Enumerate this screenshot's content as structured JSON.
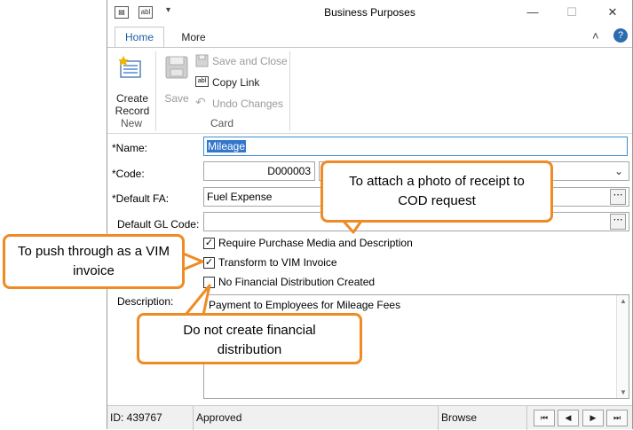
{
  "window": {
    "title": "Business Purposes",
    "minimize_glyph": "—",
    "restore_glyph": "☐",
    "close_glyph": "✕",
    "collapse_glyph": "˄",
    "help_glyph": "?"
  },
  "tabs": [
    {
      "label": "Home"
    },
    {
      "label": "More"
    }
  ],
  "ribbon": {
    "create_record": "Create Record",
    "save": "Save",
    "save_and_close": "Save and Close",
    "copy_link": "Copy Link",
    "undo_changes": "Undo Changes",
    "group_new": "New",
    "group_card": "Card"
  },
  "form": {
    "name_label": "*Name:",
    "name_value": "Mileage",
    "code_label": "*Code:",
    "code_value": "D000003",
    "default_fa_label": "*Default FA:",
    "default_fa_value": "Fuel Expense",
    "default_gl_label": "Default GL Code:",
    "default_gl_value": "",
    "chk_require_label": "Require Purchase Media and Description",
    "chk_transform_label": "Transform to VIM Invoice",
    "chk_nofin_label": "No Financial Distribution Created",
    "description_label": "Description:",
    "description_value": "Payment to Employees for Mileage Fees",
    "check_mark": "✓",
    "ellipsis": "⋯",
    "dropdown_glyph": "⌄"
  },
  "status": {
    "id": "ID: 439767",
    "state": "Approved",
    "mode": "Browse",
    "nav_first": "⏮",
    "nav_prev": "◀",
    "nav_next": "▶",
    "nav_last": "⏭"
  },
  "callouts": {
    "attach_photo": "To attach a photo of receipt to COD request",
    "push_vim": "To push through as a VIM invoice",
    "no_fin": "Do not create financial distribution"
  },
  "colors": {
    "accent": "#f08a24",
    "selection": "#3377cc",
    "tab_text": "#1a5fa8"
  }
}
